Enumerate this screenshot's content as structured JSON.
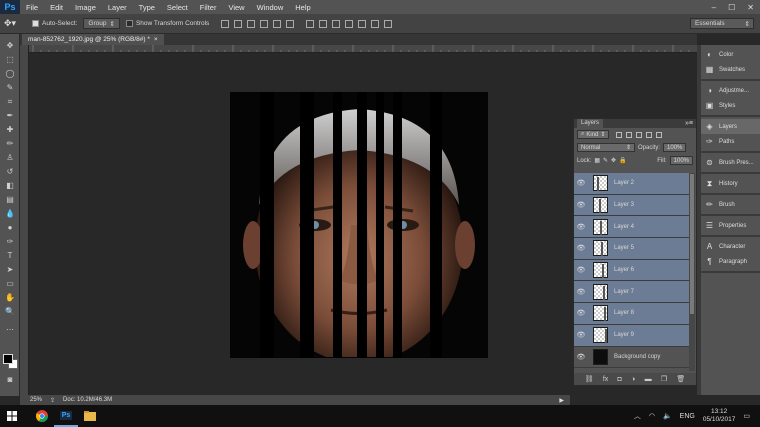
{
  "app": {
    "logo": "Ps",
    "menus": [
      "File",
      "Edit",
      "Image",
      "Layer",
      "Type",
      "Select",
      "Filter",
      "View",
      "Window",
      "Help"
    ],
    "window_controls": [
      "–",
      "☐",
      "✕"
    ]
  },
  "options_bar": {
    "auto_select_label": "Auto-Select:",
    "auto_select_checked": true,
    "auto_select_target": "Group",
    "transform_controls_label": "Show Transform Controls",
    "transform_controls_checked": false
  },
  "workspace": {
    "value": "Essentials"
  },
  "document": {
    "tab_label": "man-852762_1920.jpg @ 25% (RGB/8#) *",
    "close_label": "×"
  },
  "status": {
    "zoom": "25%",
    "doc_info": "Doc: 10.2M/46.3M"
  },
  "layers_panel": {
    "tab_label": "Layers",
    "filter_kind": "Kind",
    "blend_mode": "Normal",
    "opacity_label": "Opacity:",
    "opacity_value": "100%",
    "lock_label": "Lock:",
    "fill_label": "Fill:",
    "fill_value": "100%",
    "layers": [
      {
        "name": "Layer 2",
        "selected": true
      },
      {
        "name": "Layer 3",
        "selected": true
      },
      {
        "name": "Layer 4",
        "selected": true
      },
      {
        "name": "Layer 5",
        "selected": true
      },
      {
        "name": "Layer 6",
        "selected": true
      },
      {
        "name": "Layer 7",
        "selected": true
      },
      {
        "name": "Layer 8",
        "selected": true
      },
      {
        "name": "Layer 9",
        "selected": true
      },
      {
        "name": "Background copy",
        "selected": false
      }
    ]
  },
  "right_dock": {
    "items": [
      {
        "label": "Color",
        "icon": "color-wheel-icon"
      },
      {
        "label": "Swatches",
        "icon": "swatches-icon"
      },
      {
        "label": "Adjustme...",
        "icon": "adjustments-icon"
      },
      {
        "label": "Styles",
        "icon": "styles-icon"
      },
      {
        "label": "Layers",
        "icon": "layers-icon"
      },
      {
        "label": "Paths",
        "icon": "paths-icon"
      },
      {
        "label": "Brush Pres...",
        "icon": "brush-presets-icon"
      },
      {
        "label": "History",
        "icon": "history-icon"
      },
      {
        "label": "Brush",
        "icon": "brush-icon"
      },
      {
        "label": "Properties",
        "icon": "properties-icon"
      },
      {
        "label": "Character",
        "icon": "character-icon"
      },
      {
        "label": "Paragraph",
        "icon": "paragraph-icon"
      }
    ]
  },
  "taskbar": {
    "language": "ENG",
    "time": "13:12",
    "date": "05/10/2017"
  }
}
